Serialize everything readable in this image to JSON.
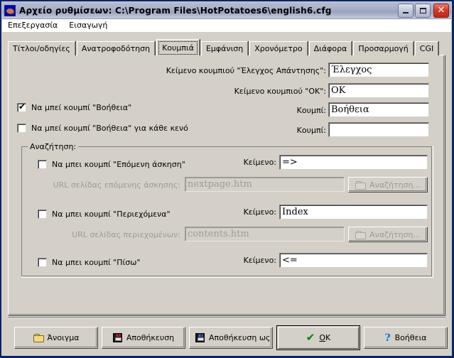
{
  "window": {
    "title": "Αρχείο ρυθμίσεων:  C:\\Program Files\\HotPotatoes6\\english6.cfg",
    "icon": "hot-potato-icon",
    "buttons": {
      "minimize": "_",
      "maximize": "□",
      "close": "✕"
    }
  },
  "menubar": {
    "items": [
      {
        "label": "Επεξεργασία"
      },
      {
        "label": "Εισαγωγή"
      }
    ]
  },
  "tabs": [
    {
      "label": "Τίτλοι/οδηγίες",
      "selected": false
    },
    {
      "label": "Ανατροφοδότηση",
      "selected": false
    },
    {
      "label": "Κουμπιά",
      "selected": true
    },
    {
      "label": "Εμφάνιση",
      "selected": false
    },
    {
      "label": "Χρονόμετρο",
      "selected": false
    },
    {
      "label": "Διάφορα",
      "selected": false
    },
    {
      "label": "Προσαρμογή",
      "selected": false
    },
    {
      "label": "CGI",
      "selected": false
    }
  ],
  "form": {
    "check_answer": {
      "label": "Κείμενο κουμπιού \"Έλεγχος Απάντησης\":",
      "value": "Έλεγχος"
    },
    "ok_button": {
      "label": "Κείμενο κουμπιού \"OK\":",
      "value": "OK"
    },
    "hint_button": {
      "checkbox_label": "Να μπεί κουμπί \"Βοήθεια\"",
      "checked": true,
      "label": "Κουμπί:",
      "value": "Βοήθεια"
    },
    "hint_each_gap": {
      "checkbox_label": "Να μπεί κουμπί \"Βοήθεια\" για κάθε κενό",
      "checked": false,
      "label": "Κουμπί:",
      "value": ""
    }
  },
  "navigation_group": {
    "title": "Αναζήτηση:",
    "next_exercise": {
      "checkbox_label": "Να μπει κουμπί \"Επόμενη άσκηση\"",
      "checked": false,
      "text_label": "Κείμενο:",
      "text_value": "=>",
      "url_label": "URL σελίδας επόμενης άσκησης:",
      "url_value": "nextpage.htm",
      "browse_label": "Αναζήτηση...",
      "browse_icon": "folder-open-icon",
      "enabled": false
    },
    "contents": {
      "checkbox_label": "Να μπει κουμπί \"Περιεχόμενα\"",
      "checked": false,
      "text_label": "Κείμενο:",
      "text_value": "Index",
      "url_label": "URL σελίδας περιεχομένων:",
      "url_value": "contents.htm",
      "browse_label": "Αναζήτηση...",
      "browse_icon": "folder-open-icon",
      "enabled": false
    },
    "back": {
      "checkbox_label": "Να μπει κουμπί \"Πίσω\"",
      "checked": false,
      "text_label": "Κείμενο:",
      "text_value": "<="
    }
  },
  "footer": {
    "open": {
      "label": "Άνοιγμα",
      "icon": "folder-open-icon"
    },
    "save": {
      "label": "Αποθήκευση",
      "icon": "floppy-disk-icon"
    },
    "save_as": {
      "label": "Αποθήκευση ως",
      "icon": "floppy-disk-save-as-icon"
    },
    "ok": {
      "label": "OK",
      "accel": "O",
      "icon": "green-check-icon",
      "default": true
    },
    "help": {
      "label": "Βοήθεια",
      "icon": "question-mark-icon"
    }
  },
  "colors": {
    "window_face": "#d4d0c8",
    "titlebar_border": "#0a246a",
    "field_background": "#ffffff",
    "disabled_text": "#9a9a94",
    "ok_check": "#008000",
    "help_question": "#1a6fd0"
  }
}
